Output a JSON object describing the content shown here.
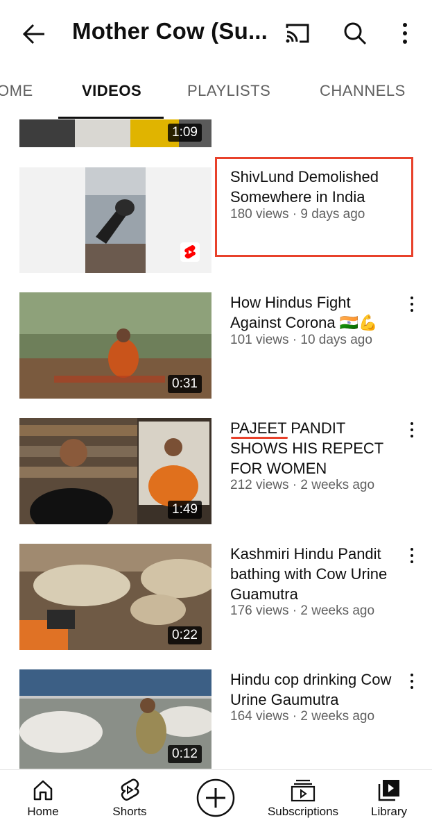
{
  "header": {
    "title": "Mother Cow (Su...",
    "icons": [
      "back-arrow-icon",
      "cast-icon",
      "search-icon",
      "more-vertical-icon"
    ]
  },
  "tabs": [
    {
      "label": "OME",
      "active": false
    },
    {
      "label": "VIDEOS",
      "active": true
    },
    {
      "label": "PLAYLISTS",
      "active": false
    },
    {
      "label": "CHANNELS",
      "active": false
    }
  ],
  "videos": [
    {
      "duration": "1:09"
    },
    {
      "title": "ShivLund Demolished Somewhere in India",
      "meta": "180 views · 9 days ago",
      "badge": "shorts-icon"
    },
    {
      "title": "How Hindus Fight Against Corona 🇮🇳💪",
      "meta": "101 views · 10 days ago",
      "duration": "0:31"
    },
    {
      "title": "PAJEET PANDIT SHOWS HIS REPECT FOR WOMEN",
      "meta": "212 views · 2 weeks ago",
      "duration": "1:49"
    },
    {
      "title": "Kashmiri Hindu Pandit bathing with Cow Urine Guamutra",
      "meta": "176 views · 2 weeks ago",
      "duration": "0:22"
    },
    {
      "title": "Hindu cop drinking Cow Urine Gaumutra",
      "meta": "164 views · 2 weeks ago",
      "duration": "0:12"
    }
  ],
  "bottom_nav": [
    {
      "label": "Home",
      "icon": "home-icon"
    },
    {
      "label": "Shorts",
      "icon": "shorts-icon"
    },
    {
      "label": "",
      "icon": "create-plus-icon"
    },
    {
      "label": "Subscriptions",
      "icon": "subscriptions-icon"
    },
    {
      "label": "Library",
      "icon": "library-icon"
    }
  ],
  "colors": {
    "highlight": "#e8412b",
    "text": "#0f0f0f",
    "secondary_text": "#606060"
  }
}
